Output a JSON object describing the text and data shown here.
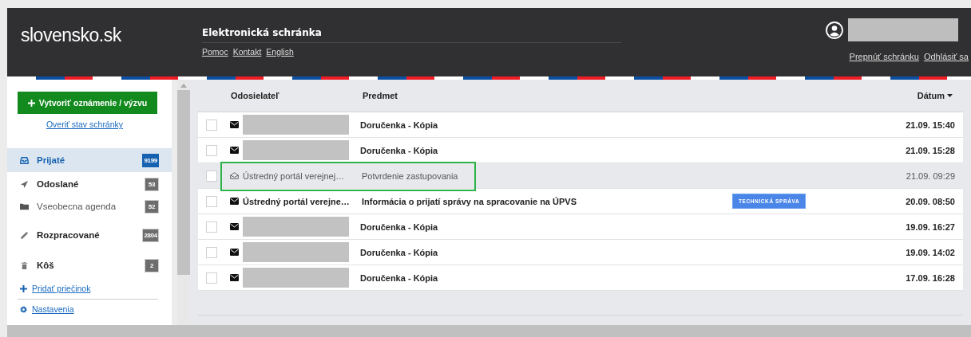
{
  "header": {
    "logo": "slovensko.sk",
    "title": "Elektronická schránka",
    "links": [
      "Pomoc",
      "Kontakt",
      "English"
    ],
    "account_links": [
      "Prepnúť schránku",
      "Odhlásiť sa"
    ]
  },
  "sidebar": {
    "create_button": "Vytvoriť oznámenie / výzvu",
    "check_link": "Overiť stav schránky",
    "folders": [
      {
        "kind": "inbox",
        "label": "Prijaté",
        "count": "9199",
        "selected": true
      },
      {
        "kind": "sent",
        "label": "Odoslané",
        "count": "53",
        "selected": false
      },
      {
        "kind": "folder",
        "label": "Vseobecna agenda",
        "count": "52",
        "selected": false
      },
      {
        "kind": "drafts",
        "label": "Rozpracované",
        "count": "2804",
        "selected": false
      },
      {
        "kind": "trash",
        "label": "Kôš",
        "count": "2",
        "selected": false
      }
    ],
    "add_folder": "Pridať priečinok",
    "settings": "Nastavenia"
  },
  "table": {
    "columns": [
      "Odosielateľ",
      "Predmet",
      "Dátum"
    ],
    "rows": [
      {
        "checked": false,
        "unread": true,
        "redacted": true,
        "subject": "Doručenka - Kópia",
        "date": "21.09. 15:40",
        "highlighted": false
      },
      {
        "checked": false,
        "unread": true,
        "redacted": true,
        "subject": "Doručenka - Kópia",
        "date": "21.09. 15:28",
        "highlighted": false
      },
      {
        "checked": false,
        "unread": false,
        "redacted": false,
        "sender": "Ústredný portál verejnej…",
        "subject": "Potvrdenie zastupovania",
        "date": "21.09. 09:29",
        "highlighted": true
      },
      {
        "checked": false,
        "unread": true,
        "redacted": false,
        "sender": "Ústredný portál verejne…",
        "subject": "Informácia o prijatí správy na spracovanie na ÚPVS",
        "tag": "TECHNICKÁ SPRÁVA",
        "date": "20.09. 08:50",
        "highlighted": false
      },
      {
        "checked": false,
        "unread": true,
        "redacted": true,
        "subject": "Doručenka - Kópia",
        "date": "19.09. 16:27",
        "highlighted": false
      },
      {
        "checked": false,
        "unread": true,
        "redacted": true,
        "subject": "Doručenka - Kópia",
        "date": "19.09. 14:02",
        "highlighted": false
      },
      {
        "checked": false,
        "unread": true,
        "redacted": true,
        "subject": "Doručenka - Kópia",
        "date": "17.09. 16:28",
        "highlighted": false
      }
    ]
  }
}
